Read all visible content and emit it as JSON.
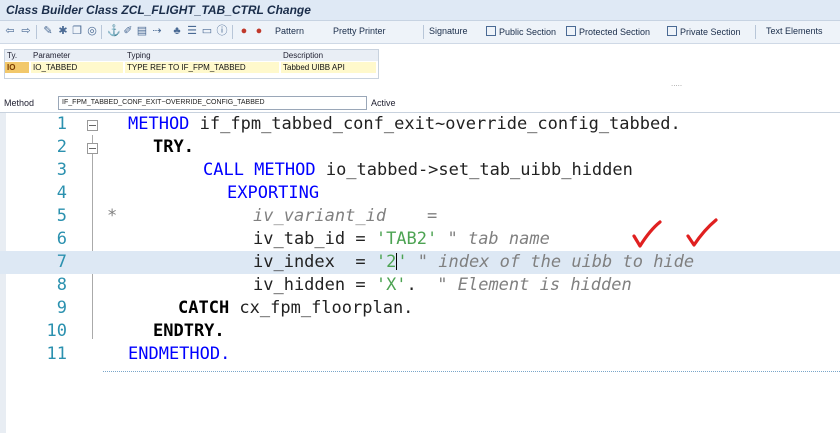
{
  "window": {
    "title": "Class Builder Class ZCL_FLIGHT_TAB_CTRL Change"
  },
  "toolbar": {
    "icons": [
      "back-icon",
      "forward-icon",
      "other-object-icon",
      "display-change-icon",
      "activate-icon",
      "check-icon",
      "where-used-icon",
      "object-list-icon",
      "hierarchy-icon",
      "navigation-window-icon",
      "layout-icon",
      "info-icon",
      "enhance-icon",
      "find-icon"
    ],
    "pattern": "Pattern",
    "pretty_printer": "Pretty Printer",
    "signature": "Signature",
    "public_section": "Public Section",
    "protected_section": "Protected Section",
    "private_section": "Private Section",
    "text_elements": "Text Elements"
  },
  "params": {
    "headers": {
      "ty": "Ty.",
      "parameter": "Parameter",
      "typing": "Typing",
      "description": "Description"
    },
    "row": {
      "ty": "IO",
      "parameter": "IO_TABBED",
      "typing": "TYPE REF TO IF_FPM_TABBED",
      "description": "Tabbed UIBB API"
    },
    "more": "....."
  },
  "method": {
    "label": "Method",
    "name": "IF_FPM_TABBED_CONF_EXIT~OVERRIDE_CONFIG_TABBED",
    "status": "Active"
  },
  "code": {
    "l1": {
      "n": "1",
      "kw": "METHOD",
      "rest": " if_fpm_tabbed_conf_exit~override_config_tabbed."
    },
    "l2": {
      "n": "2",
      "kw": "TRY",
      "rest": "."
    },
    "l3": {
      "n": "3",
      "kw": "CALL METHOD",
      "rest": " io_tabbed->set_tab_uibb_hidden"
    },
    "l4": {
      "n": "4",
      "kw": "EXPORTING"
    },
    "l5": {
      "n": "5",
      "star": "*",
      "cmt": "iv_variant_id    ="
    },
    "l6": {
      "n": "6",
      "a": "iv_tab_id = ",
      "s": "'TAB2'",
      "c": " \" tab name"
    },
    "l7": {
      "n": "7",
      "a": "iv_index  = ",
      "s1": "'2",
      "s2": "'",
      "c": " \" index of the uibb to hide"
    },
    "l8": {
      "n": "8",
      "a": "iv_hidden = ",
      "s": "'X'",
      "p": ".",
      "c": "  \" Element is hidden"
    },
    "l9": {
      "n": "9",
      "kw": "CATCH",
      "rest": " cx_fpm_floorplan."
    },
    "l10": {
      "n": "10",
      "kw": "ENDTRY",
      "rest": "."
    },
    "l11": {
      "n": "11",
      "kw": "ENDMETHOD",
      "rest": "."
    }
  },
  "annotations": {
    "checkmark_color": "#e02020",
    "count": 2
  }
}
